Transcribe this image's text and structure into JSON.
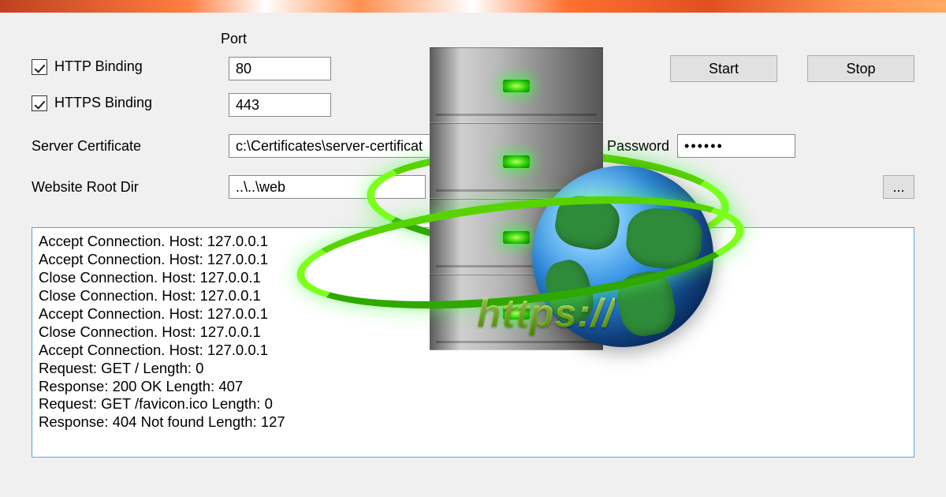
{
  "header": {
    "port_label": "Port"
  },
  "bindings": {
    "http": {
      "label": "HTTP Binding",
      "port": "80",
      "checked": true
    },
    "https": {
      "label": "HTTPS Binding",
      "port": "443",
      "checked": true
    }
  },
  "buttons": {
    "start": "Start",
    "stop": "Stop",
    "browse": "..."
  },
  "cert": {
    "label": "Server Certificate",
    "value": "c:\\Certificates\\server-certificat"
  },
  "password": {
    "label": "Password",
    "value": "••••••"
  },
  "rootdir": {
    "label": "Website Root Dir",
    "value": "..\\..\\web"
  },
  "illustration": {
    "protocol_text": "https://"
  },
  "log": {
    "lines": [
      "Accept Connection. Host: 127.0.0.1",
      "Accept Connection. Host: 127.0.0.1",
      "Close Connection. Host: 127.0.0.1",
      "Close Connection. Host: 127.0.0.1",
      "Accept Connection. Host: 127.0.0.1",
      "Close Connection. Host: 127.0.0.1",
      "Accept Connection. Host: 127.0.0.1",
      "Request: GET / Length: 0",
      "Response: 200 OK Length: 407",
      "Request: GET /favicon.ico Length: 0",
      "Response: 404 Not found Length: 127"
    ]
  }
}
